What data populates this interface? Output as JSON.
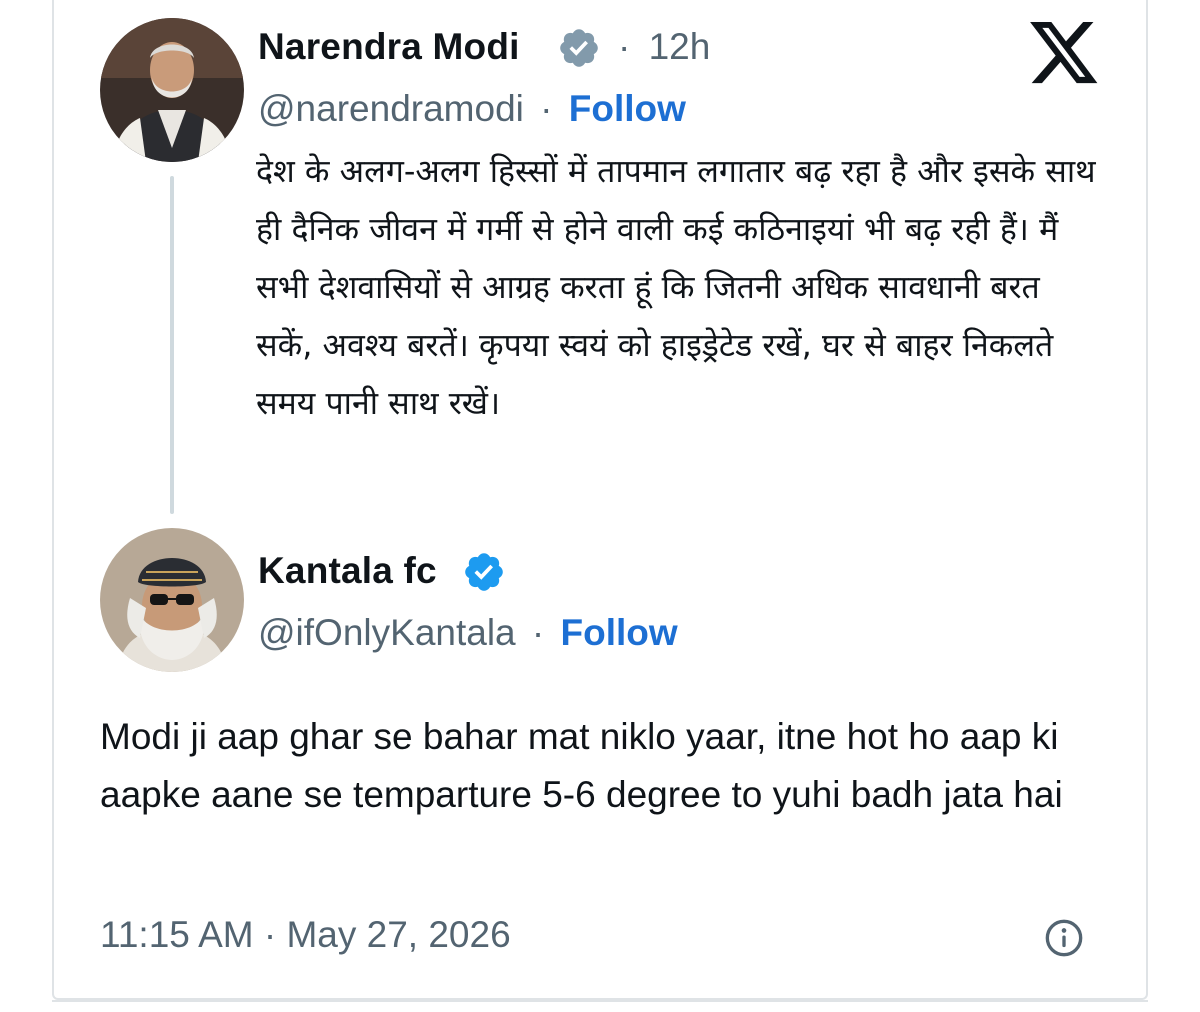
{
  "original_tweet": {
    "author_name": "Narendra Modi",
    "handle": "@narendramodi",
    "separator": "·",
    "time_ago": "12h",
    "follow_label": "Follow",
    "text": "देश के अलग-अलग हिस्सों में तापमान लगातार बढ़ रहा है और इसके साथ ही दैनिक जीवन में गर्मी से होने वाली कई कठिनाइयां भी बढ़ रही हैं। मैं सभी देशवासियों से आग्रह करता हूं कि जितनी अधिक सावधानी बरत सकें, अवश्य बरतें। कृपया स्वयं को हाइड्रेटेड रखें, घर से बाहर निकलते समय पानी साथ रखें।",
    "verified_badge_color": "#829aab"
  },
  "reply_tweet": {
    "author_name": "Kantala fc",
    "handle": "@ifOnlyKantala",
    "separator": "·",
    "follow_label": "Follow",
    "text": "Modi ji aap ghar se bahar mat niklo yaar, itne hot ho aap ki aapke aane se temparture 5-6 degree to yuhi badh jata hai",
    "timestamp": "11:15 AM · May 27, 2026",
    "verified_badge_color": "#1d9bf0"
  },
  "icons": {
    "platform_logo": "x-logo-icon",
    "info": "info-icon"
  },
  "colors": {
    "link": "#1d6fd3",
    "secondary_text": "#536471",
    "border": "#dfe3e6"
  }
}
